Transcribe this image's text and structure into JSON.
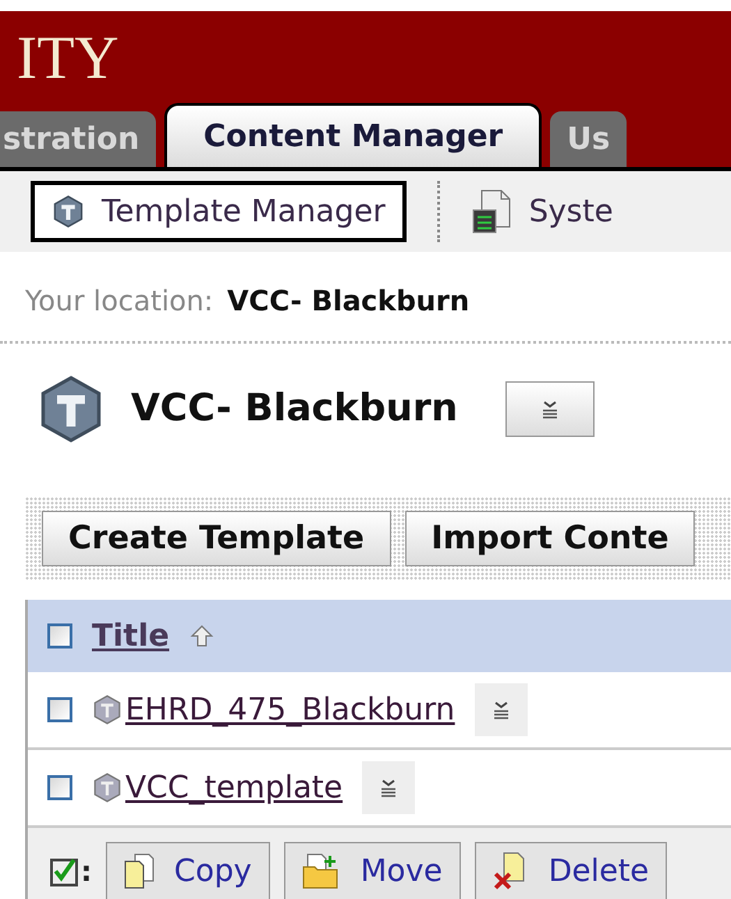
{
  "header": {
    "logo_text": "ITY"
  },
  "tabs": [
    {
      "label": "stration",
      "selected": false
    },
    {
      "label": "Content Manager",
      "selected": true
    },
    {
      "label": "Us",
      "selected": false
    }
  ],
  "toolbar": [
    {
      "label": "Template Manager",
      "selected": true,
      "kind": "template"
    },
    {
      "label": "Syste",
      "selected": false,
      "kind": "system"
    }
  ],
  "location": {
    "label": "Your location:",
    "value": "VCC- Blackburn"
  },
  "heading": {
    "title": "VCC- Blackburn"
  },
  "actions": [
    "Create Template",
    "Import Conte"
  ],
  "table": {
    "header": {
      "title": "Title",
      "checked": false
    },
    "rows": [
      {
        "title": "EHRD_475_Blackburn",
        "checked": false
      },
      {
        "title": "VCC_template",
        "checked": false
      }
    ]
  },
  "footer": {
    "separator": ":",
    "buttons": [
      {
        "label": "Copy",
        "kind": "copy"
      },
      {
        "label": "Move",
        "kind": "move"
      },
      {
        "label": "Delete",
        "kind": "delete"
      }
    ]
  }
}
